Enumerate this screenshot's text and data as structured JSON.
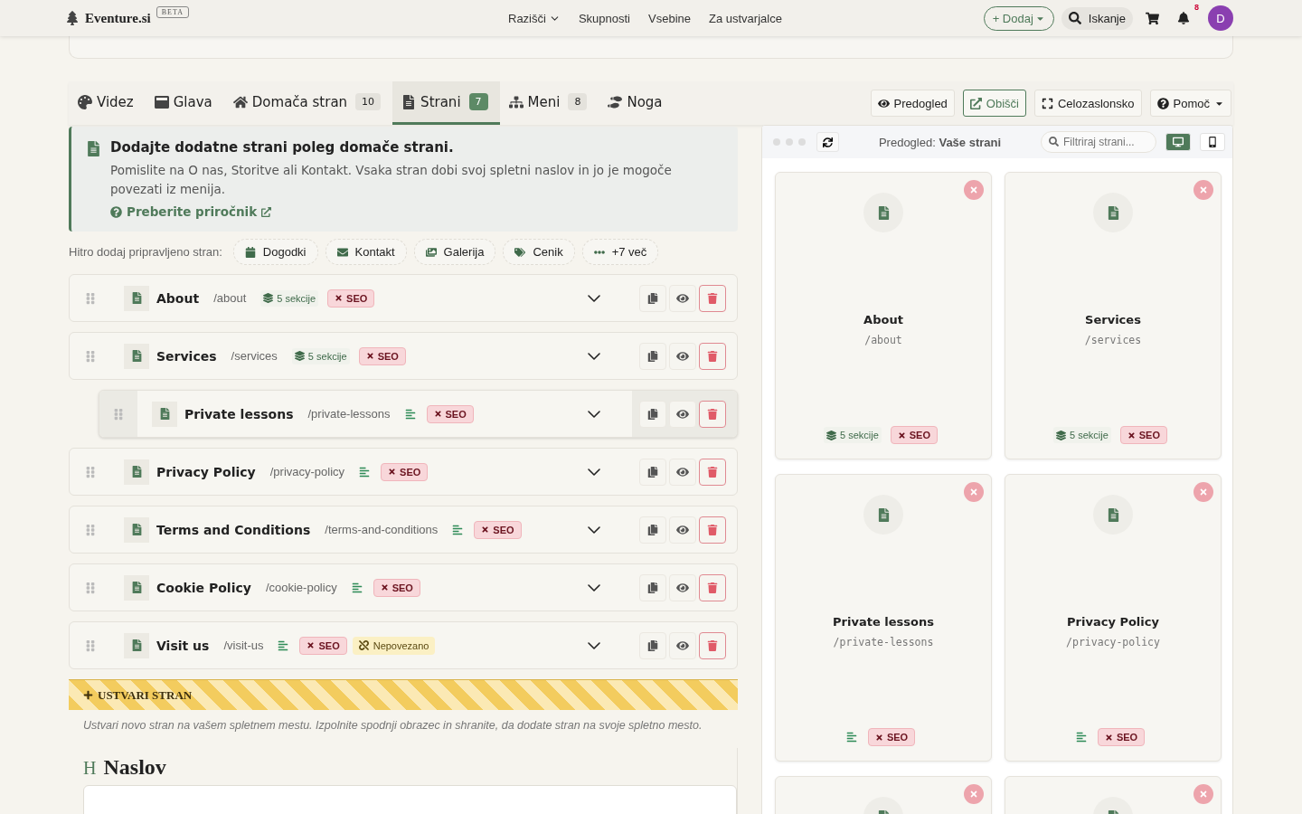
{
  "nav": {
    "logo": "Eventure.si",
    "beta": "BETA",
    "links": [
      {
        "label": "Razišči",
        "dropdown": true
      },
      {
        "label": "Skupnosti",
        "dropdown": false
      },
      {
        "label": "Vsebine",
        "dropdown": false
      },
      {
        "label": "Za ustvarjalce",
        "dropdown": false
      }
    ],
    "add_button": "+ Dodaj",
    "search": "Iskanje",
    "notifications": "8",
    "avatar": "D"
  },
  "tabs": [
    {
      "label": "Videz",
      "selected": false
    },
    {
      "label": "Glava",
      "selected": false
    },
    {
      "label": "Domača stran",
      "count": "10",
      "selected": false
    },
    {
      "label": "Strani",
      "count": "7",
      "selected": true
    },
    {
      "label": "Meni",
      "count": "8",
      "selected": false
    },
    {
      "label": "Noga",
      "selected": false
    }
  ],
  "toolbar": [
    {
      "label": "Predogled",
      "kind": "plain"
    },
    {
      "label": "Obišči",
      "kind": "outline"
    },
    {
      "label": "Celozaslonsko",
      "kind": "plain"
    },
    {
      "label": "Pomoč",
      "kind": "dropdown"
    }
  ],
  "info": {
    "title": "Dodajte dodatne strani poleg domače strani.",
    "text": "Pomislite na O nas, Storitve ali Kontakt. Vsaka stran dobi svoj spletni naslov in jo je mogoče povezati iz menija.",
    "link": "Preberite priročnik"
  },
  "quick_add": {
    "label": "Hitro dodaj pripravljeno stran:",
    "items": [
      "Dogodki",
      "Kontakt",
      "Galerija",
      "Cenik",
      "+7 več"
    ]
  },
  "pages": [
    {
      "name": "About",
      "path": "/about",
      "content": {
        "kind": "sections",
        "label": "5 sekcije"
      },
      "seo": "SEO"
    },
    {
      "name": "Services",
      "path": "/services",
      "content": {
        "kind": "sections",
        "label": "5 sekcije"
      },
      "seo": "SEO",
      "children": [
        {
          "name": "Private lessons",
          "path": "/private-lessons",
          "content": {
            "kind": "text"
          },
          "seo": "SEO"
        }
      ]
    },
    {
      "name": "Privacy Policy",
      "path": "/privacy-policy",
      "content": {
        "kind": "text"
      },
      "seo": "SEO"
    },
    {
      "name": "Terms and Conditions",
      "path": "/terms-and-conditions",
      "content": {
        "kind": "text"
      },
      "seo": "SEO"
    },
    {
      "name": "Cookie Policy",
      "path": "/cookie-policy",
      "content": {
        "kind": "text"
      },
      "seo": "SEO"
    },
    {
      "name": "Visit us",
      "path": "/visit-us",
      "content": {
        "kind": "text"
      },
      "seo": "SEO",
      "unlinked": "Nepovezano"
    }
  ],
  "create": {
    "title": "USTVARI STRAN",
    "description": "Ustvari novo stran na vašem spletnem mestu. Izpolnite spodnji obrazec in shranite, da dodate stran na svoje spletno mesto.",
    "heading_icon": "H",
    "heading": "Naslov"
  },
  "preview": {
    "title": "Predogled: **Vaše strani**",
    "search_placeholder": "Filtriraj strani...",
    "devices": [
      {
        "kind": "desktop",
        "selected": true
      },
      {
        "kind": "mobile",
        "selected": false
      }
    ],
    "cards": [
      {
        "kind": "full",
        "title": "About",
        "path": "/about",
        "content": {
          "kind": "sections",
          "label": "5 sekcije"
        },
        "seo": "SEO"
      },
      {
        "kind": "full",
        "title": "Services",
        "path": "/services",
        "content": {
          "kind": "sections",
          "label": "5 sekcije"
        },
        "seo": "SEO"
      },
      {
        "kind": "full",
        "title": "Private lessons",
        "path": "/private-lessons",
        "content": {
          "kind": "text"
        },
        "seo": "SEO"
      },
      {
        "kind": "full",
        "title": "Privacy Policy",
        "path": "/privacy-policy",
        "content": {
          "kind": "text"
        },
        "seo": "SEO"
      },
      {
        "kind": "cut"
      },
      {
        "kind": "cut"
      }
    ]
  }
}
